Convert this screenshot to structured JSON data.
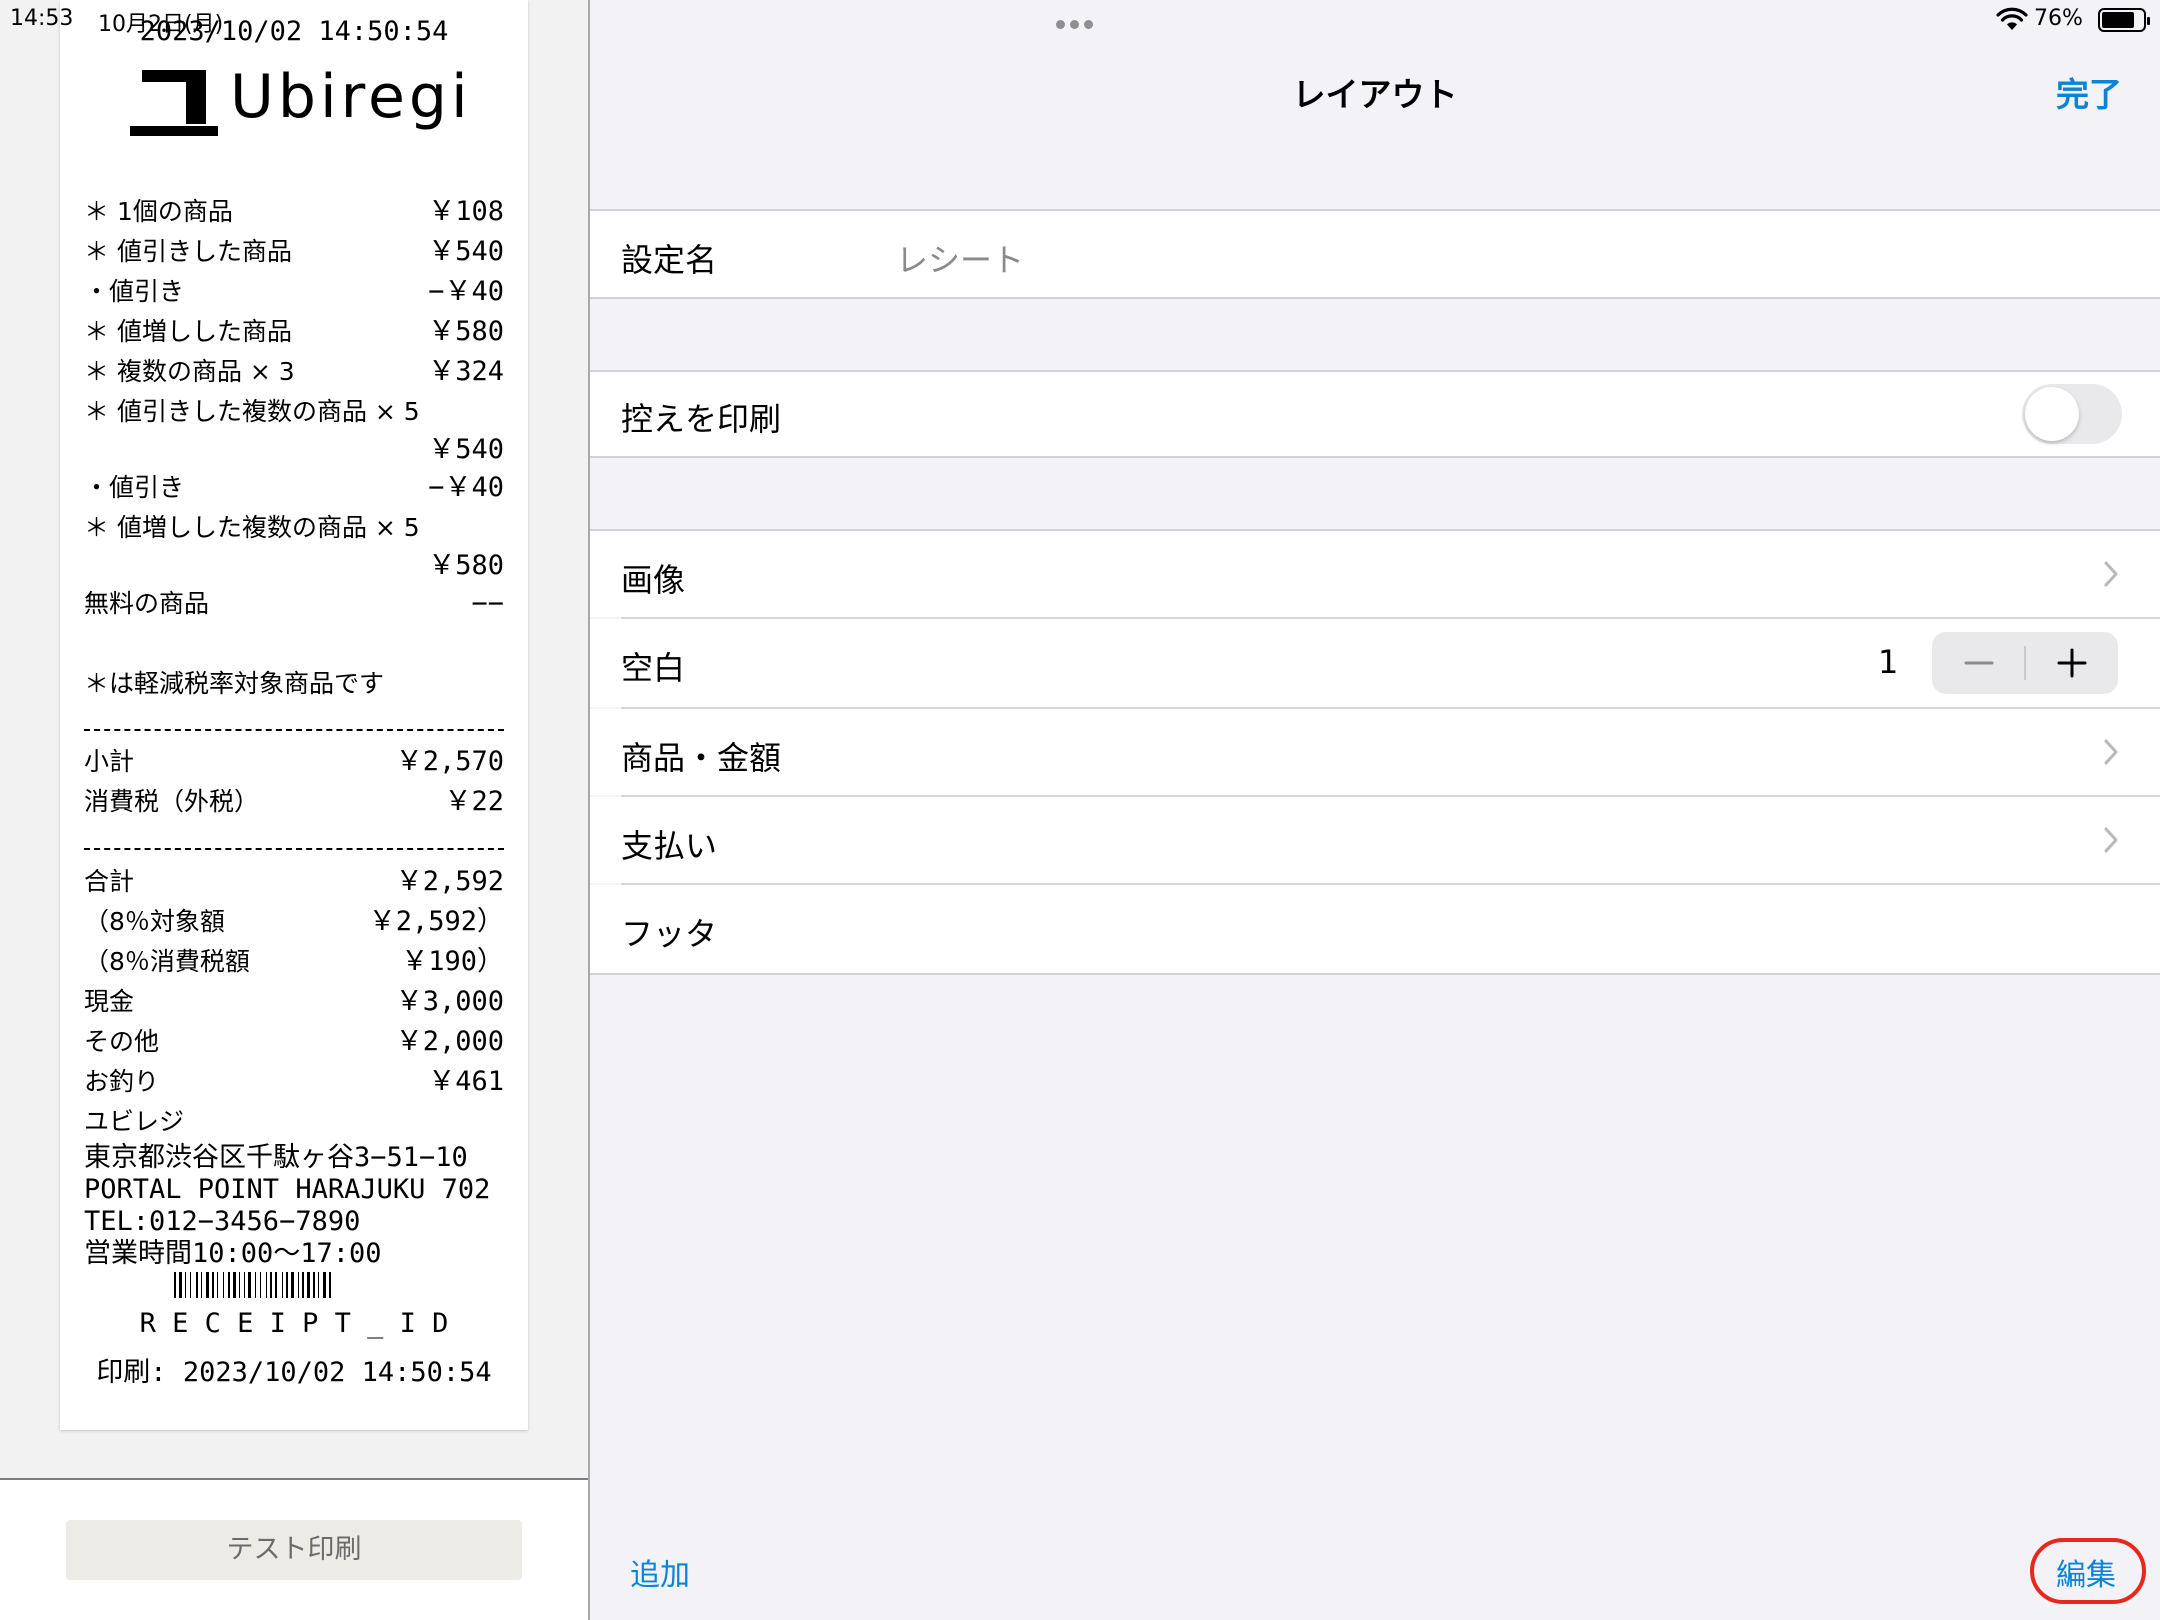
{
  "status_bar": {
    "time": "14:53",
    "date": "10月2日(月)",
    "battery": "76%"
  },
  "receipt": {
    "top_datetime": "2023/10/02 14:50:54",
    "logo_text": "Ubiregi",
    "items": [
      {
        "left": "＊ 1個の商品",
        "right": "￥108"
      },
      {
        "left": "＊ 値引きした商品",
        "right": "￥540"
      },
      {
        "left": "・値引き",
        "right": "−￥40"
      },
      {
        "left": "＊ 値増しした商品",
        "right": "￥580"
      },
      {
        "left": "＊ 複数の商品 × 3",
        "right": "￥324"
      },
      {
        "left": "＊ 値引きした複数の商品 × 5",
        "right": ""
      },
      {
        "left": "",
        "right": "￥540"
      },
      {
        "left": "・値引き",
        "right": "−￥40"
      },
      {
        "left": "＊ 値増しした複数の商品 × 5",
        "right": ""
      },
      {
        "left": "",
        "right": "￥580"
      },
      {
        "left": "無料の商品",
        "right": "−−"
      }
    ],
    "reduced_tax_note": "＊は軽減税率対象商品です",
    "subtotals": [
      {
        "left": "小計",
        "right": "￥2,570"
      },
      {
        "left": "消費税（外税）",
        "right": "￥22"
      }
    ],
    "totals": [
      {
        "left": "合計",
        "right": "￥2,592"
      },
      {
        "left": "（8％対象額",
        "right": "￥2,592）"
      },
      {
        "left": "（8％消費税額",
        "right": "￥190）"
      },
      {
        "left": "現金",
        "right": "￥3,000"
      },
      {
        "left": "その他",
        "right": "￥2,000"
      },
      {
        "left": "お釣り",
        "right": "￥461"
      }
    ],
    "store_name": "ユビレジ",
    "address_1": "東京都渋谷区千駄ヶ谷3−51−10",
    "address_2": "PORTAL POINT HARAJUKU 702",
    "tel": "TEL:012−3456−7890",
    "hours": "営業時間10:00〜17:00",
    "receipt_id": "R E C E I P T _ I D",
    "printed": "印刷: 2023/10/02 14:50:54"
  },
  "test_print_label": "テスト印刷",
  "nav": {
    "title": "レイアウト",
    "done": "完了"
  },
  "settings": {
    "name_label": "設定名",
    "name_placeholder": "レシート",
    "print_copy_label": "控えを印刷",
    "print_copy_on": false,
    "image_label": "画像",
    "blank_label": "空白",
    "blank_value": "1",
    "items_amount_label": "商品・金額",
    "payment_label": "支払い",
    "footer_label": "フッタ"
  },
  "bottom": {
    "add": "追加",
    "edit": "編集"
  },
  "colors": {
    "accent": "#0a84d6",
    "highlight_ring": "#e8281f"
  }
}
